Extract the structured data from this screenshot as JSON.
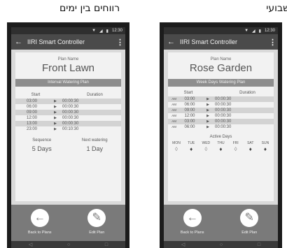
{
  "captions": {
    "left": "רווחים בין ימים",
    "right": "שבועי"
  },
  "status": {
    "time": "12:30",
    "wifi": "▼",
    "signal": "◢",
    "battery": "▮"
  },
  "appbar": {
    "back_icon": "←",
    "title": "IIRI Smart Controller",
    "menu_icon": "⋮"
  },
  "left_phone": {
    "plan_label": "Plan Name",
    "plan_name": "Front Lawn",
    "plan_type": "Interval Watering Plan",
    "col_start": "Start",
    "col_duration": "Duration",
    "rows": [
      {
        "start": "03:00",
        "duration": "00:00:30"
      },
      {
        "start": "06:00",
        "duration": "00:00:30"
      },
      {
        "start": "09:00",
        "duration": "00:00:30"
      },
      {
        "start": "12:00",
        "duration": "00:00:30"
      },
      {
        "start": "13:00",
        "duration": "00:00:30"
      },
      {
        "start": "23:00",
        "duration": "00:10:30"
      }
    ],
    "sequence_label": "Sequence",
    "sequence_value": "5 Days",
    "next_label": "Next watering",
    "next_value": "1 Day",
    "back_label": "Back to Plans",
    "edit_label": "Edit Plan"
  },
  "right_phone": {
    "plan_label": "Plan Name",
    "plan_name": "Rose Garden",
    "plan_type": "Week Days Watering Plan",
    "col_start": "Start",
    "col_duration": "Duration",
    "rows": [
      {
        "ampm": "AM",
        "start": "03:00",
        "duration": "00:00:30"
      },
      {
        "ampm": "AM",
        "start": "06:00",
        "duration": "00:00:30"
      },
      {
        "ampm": "AM",
        "start": "09:00",
        "duration": "00:00:30"
      },
      {
        "ampm": "AM",
        "start": "12:00",
        "duration": "00:00:30"
      },
      {
        "ampm": "AM",
        "start": "03:00",
        "duration": "00:00:30"
      },
      {
        "ampm": "AM",
        "start": "06:00",
        "duration": "00:00:30"
      }
    ],
    "active_days_label": "Active Days",
    "days": [
      {
        "name": "MON",
        "active": false
      },
      {
        "name": "TUE",
        "active": true
      },
      {
        "name": "WED",
        "active": false
      },
      {
        "name": "THU",
        "active": true
      },
      {
        "name": "FRI",
        "active": false
      },
      {
        "name": "SAT",
        "active": true
      },
      {
        "name": "SUN",
        "active": true
      }
    ],
    "back_label": "Back to Plans",
    "edit_label": "Edit Plan"
  },
  "icons": {
    "back_arrow": "←",
    "edit_pencil": "✎",
    "nav_back": "◁",
    "nav_home": "○",
    "nav_recent": "□",
    "row_arrow": "▶",
    "drop": "💧"
  }
}
